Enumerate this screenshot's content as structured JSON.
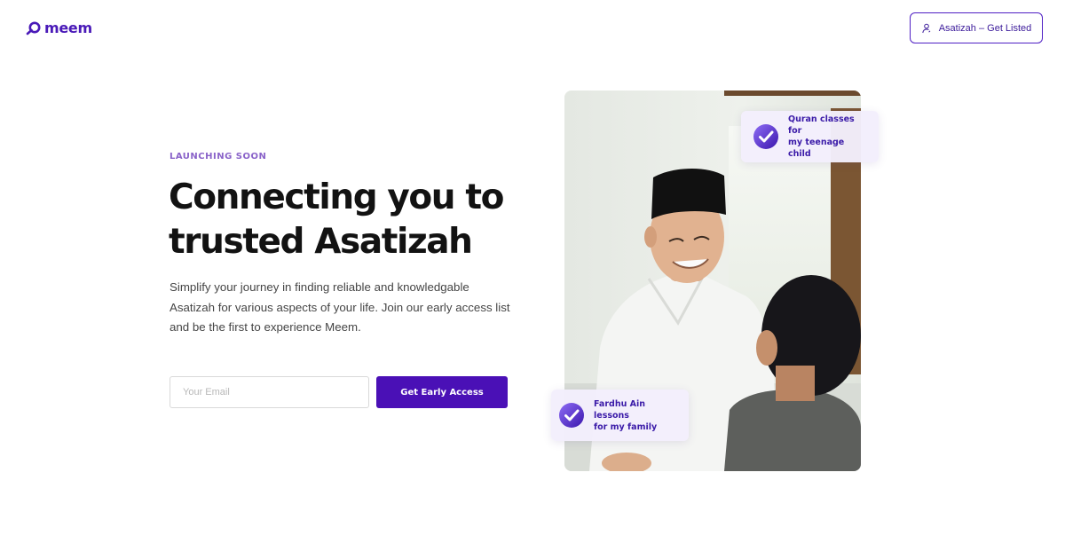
{
  "header": {
    "logo_text": "meem",
    "get_listed_label": "Asatizah – Get Listed"
  },
  "hero": {
    "kicker": "LAUNCHING SOON",
    "headline": "Connecting you to trusted Asatizah",
    "description": "Simplify your journey in finding reliable and knowledgable Asatizah for various aspects of your life. Join our early access list and be the first to experience Meem."
  },
  "form": {
    "email_placeholder": "Your Email",
    "email_value": "",
    "cta_label": "Get Early Access"
  },
  "chips": {
    "top": "Quran classes for\nmy teenage child",
    "bottom": "Fardhu Ain lessons\nfor my family"
  },
  "colors": {
    "brand": "#4a10b6",
    "kicker": "#8a63c9",
    "chip_bg": "#f3eefc",
    "chip_text": "#3a1aa8"
  },
  "icons": {
    "header_button": "user-icon",
    "chip": "check-circle-icon"
  }
}
